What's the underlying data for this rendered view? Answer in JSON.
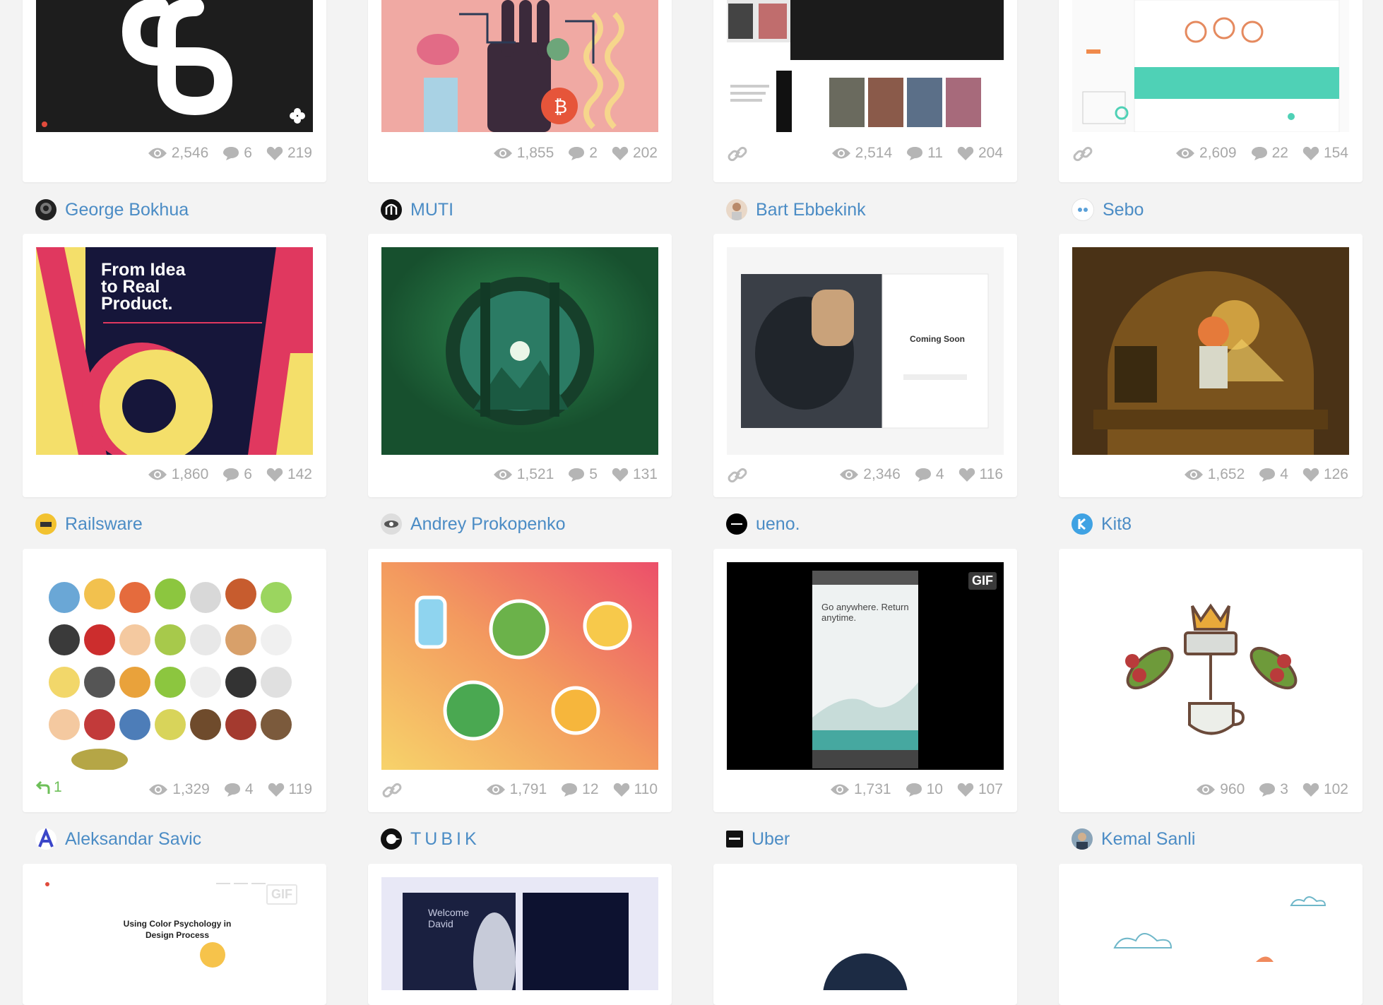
{
  "row1": [
    {
      "views": "2,546",
      "comments": "6",
      "likes": "219"
    },
    {
      "views": "1,855",
      "comments": "2",
      "likes": "202"
    },
    {
      "views": "2,514",
      "comments": "11",
      "likes": "204"
    },
    {
      "views": "2,609",
      "comments": "22",
      "likes": "154"
    }
  ],
  "authors1": [
    "George Bokhua",
    "MUTI",
    "Bart Ebbekink",
    "Sebo"
  ],
  "row2": [
    {
      "views": "1,860",
      "comments": "6",
      "likes": "142",
      "art_text": "From Idea to Real Product."
    },
    {
      "views": "1,521",
      "comments": "5",
      "likes": "131"
    },
    {
      "views": "2,346",
      "comments": "4",
      "likes": "116",
      "art_text": "Coming Soon"
    },
    {
      "views": "1,652",
      "comments": "4",
      "likes": "126"
    }
  ],
  "authors2": [
    "Railsware",
    "Andrey Prokopenko",
    "ueno.",
    "Kit8"
  ],
  "row3": [
    {
      "views": "1,329",
      "comments": "4",
      "likes": "119",
      "rebound": "1"
    },
    {
      "views": "1,791",
      "comments": "12",
      "likes": "110"
    },
    {
      "views": "1,731",
      "comments": "10",
      "likes": "107",
      "gif": "GIF",
      "art_text": "Go anywhere. Return anytime."
    },
    {
      "views": "960",
      "comments": "3",
      "likes": "102"
    }
  ],
  "authors3": [
    "Aleksandar Savic",
    "TUBIK",
    "Uber",
    "Kemal Sanli"
  ],
  "row4": [
    {
      "gif": "GIF",
      "art_text": "Using Color Psychology in Design Process"
    },
    {
      "art_text": "Welcome David"
    },
    {},
    {}
  ],
  "colors": {
    "author_link": "#4b8cc5",
    "stat_gray": "#a8a8a8",
    "rebound_green": "#6dbf58",
    "background": "#f3f3f3"
  }
}
